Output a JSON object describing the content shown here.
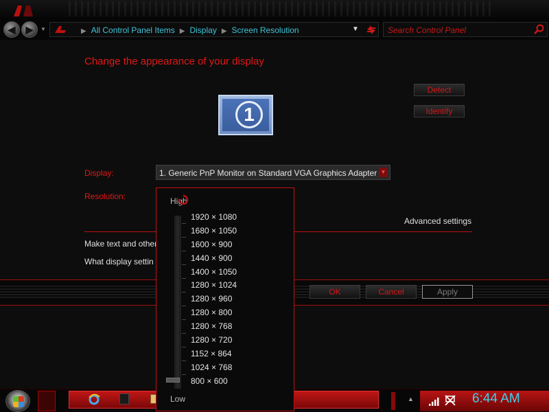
{
  "address_bar": {
    "breadcrumbs": [
      "All Control Panel Items",
      "Display",
      "Screen Resolution"
    ],
    "search_placeholder": "Search Control Panel"
  },
  "page": {
    "title": "Change the appearance of your display",
    "monitor_number": "1",
    "detect_label": "Detect",
    "identify_label": "Identify",
    "display_label": "Display:",
    "display_value": "1. Generic PnP Monitor on Standard VGA Graphics Adapter",
    "resolution_label": "Resolution:",
    "advanced_settings": "Advanced settings",
    "text_link": "Make text and other",
    "what_link": "What display settin",
    "ok_label": "OK",
    "cancel_label": "Cancel",
    "apply_label": "Apply"
  },
  "resolution_popup": {
    "high_label": "High",
    "low_label": "Low",
    "options": [
      "1920 × 1080",
      "1680 × 1050",
      "1600 × 900",
      "1440 × 900",
      "1400 × 1050",
      "1280 × 1024",
      "1280 × 960",
      "1280 × 800",
      "1280 × 768",
      "1280 × 720",
      "1152 × 864",
      "1024 × 768",
      "800 × 600"
    ],
    "selected": "800 × 600"
  },
  "taskbar": {
    "clock": "6:44 AM"
  },
  "colors": {
    "accent_red": "#e01818",
    "link_cyan": "#3fc4d8"
  },
  "icons": [
    "back-arrow-icon",
    "forward-arrow-icon",
    "control-panel-icon",
    "refresh-icon",
    "search-icon",
    "windows-start-icon",
    "internet-explorer-icon",
    "signal-icon",
    "network-icon"
  ]
}
